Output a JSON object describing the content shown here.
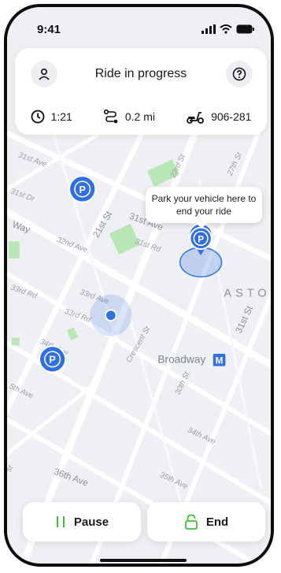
{
  "status": {
    "time": "9:41"
  },
  "header": {
    "title": "Ride in progress",
    "duration": "1:21",
    "distance": "0.2 mi",
    "vehicle_id": "906-281"
  },
  "map": {
    "tooltip": "Park your vehicle here to end your ride",
    "district_label": "ASTO",
    "station_label": "Broadway",
    "station_badge": "M",
    "parking_symbol": "P",
    "streets": [
      "31st Ave",
      "31st Dr",
      "23rd St",
      "27th St",
      "21st St",
      "31st Ave",
      "31st Rd",
      "32nd Ave",
      "Way",
      "33rd Rd",
      "33rd Ave",
      "33rd Rd",
      "Crescent St",
      "31st St",
      "34th Ave",
      "5th Ave",
      "30th St",
      "34th Ave",
      "36th Ave",
      "35th Ave",
      "st"
    ]
  },
  "actions": {
    "pause_label": "Pause",
    "end_label": "End"
  },
  "colors": {
    "accent_blue": "#2f6fe0",
    "end_green": "#3cc13b",
    "pause_green": "#3cc13b"
  }
}
